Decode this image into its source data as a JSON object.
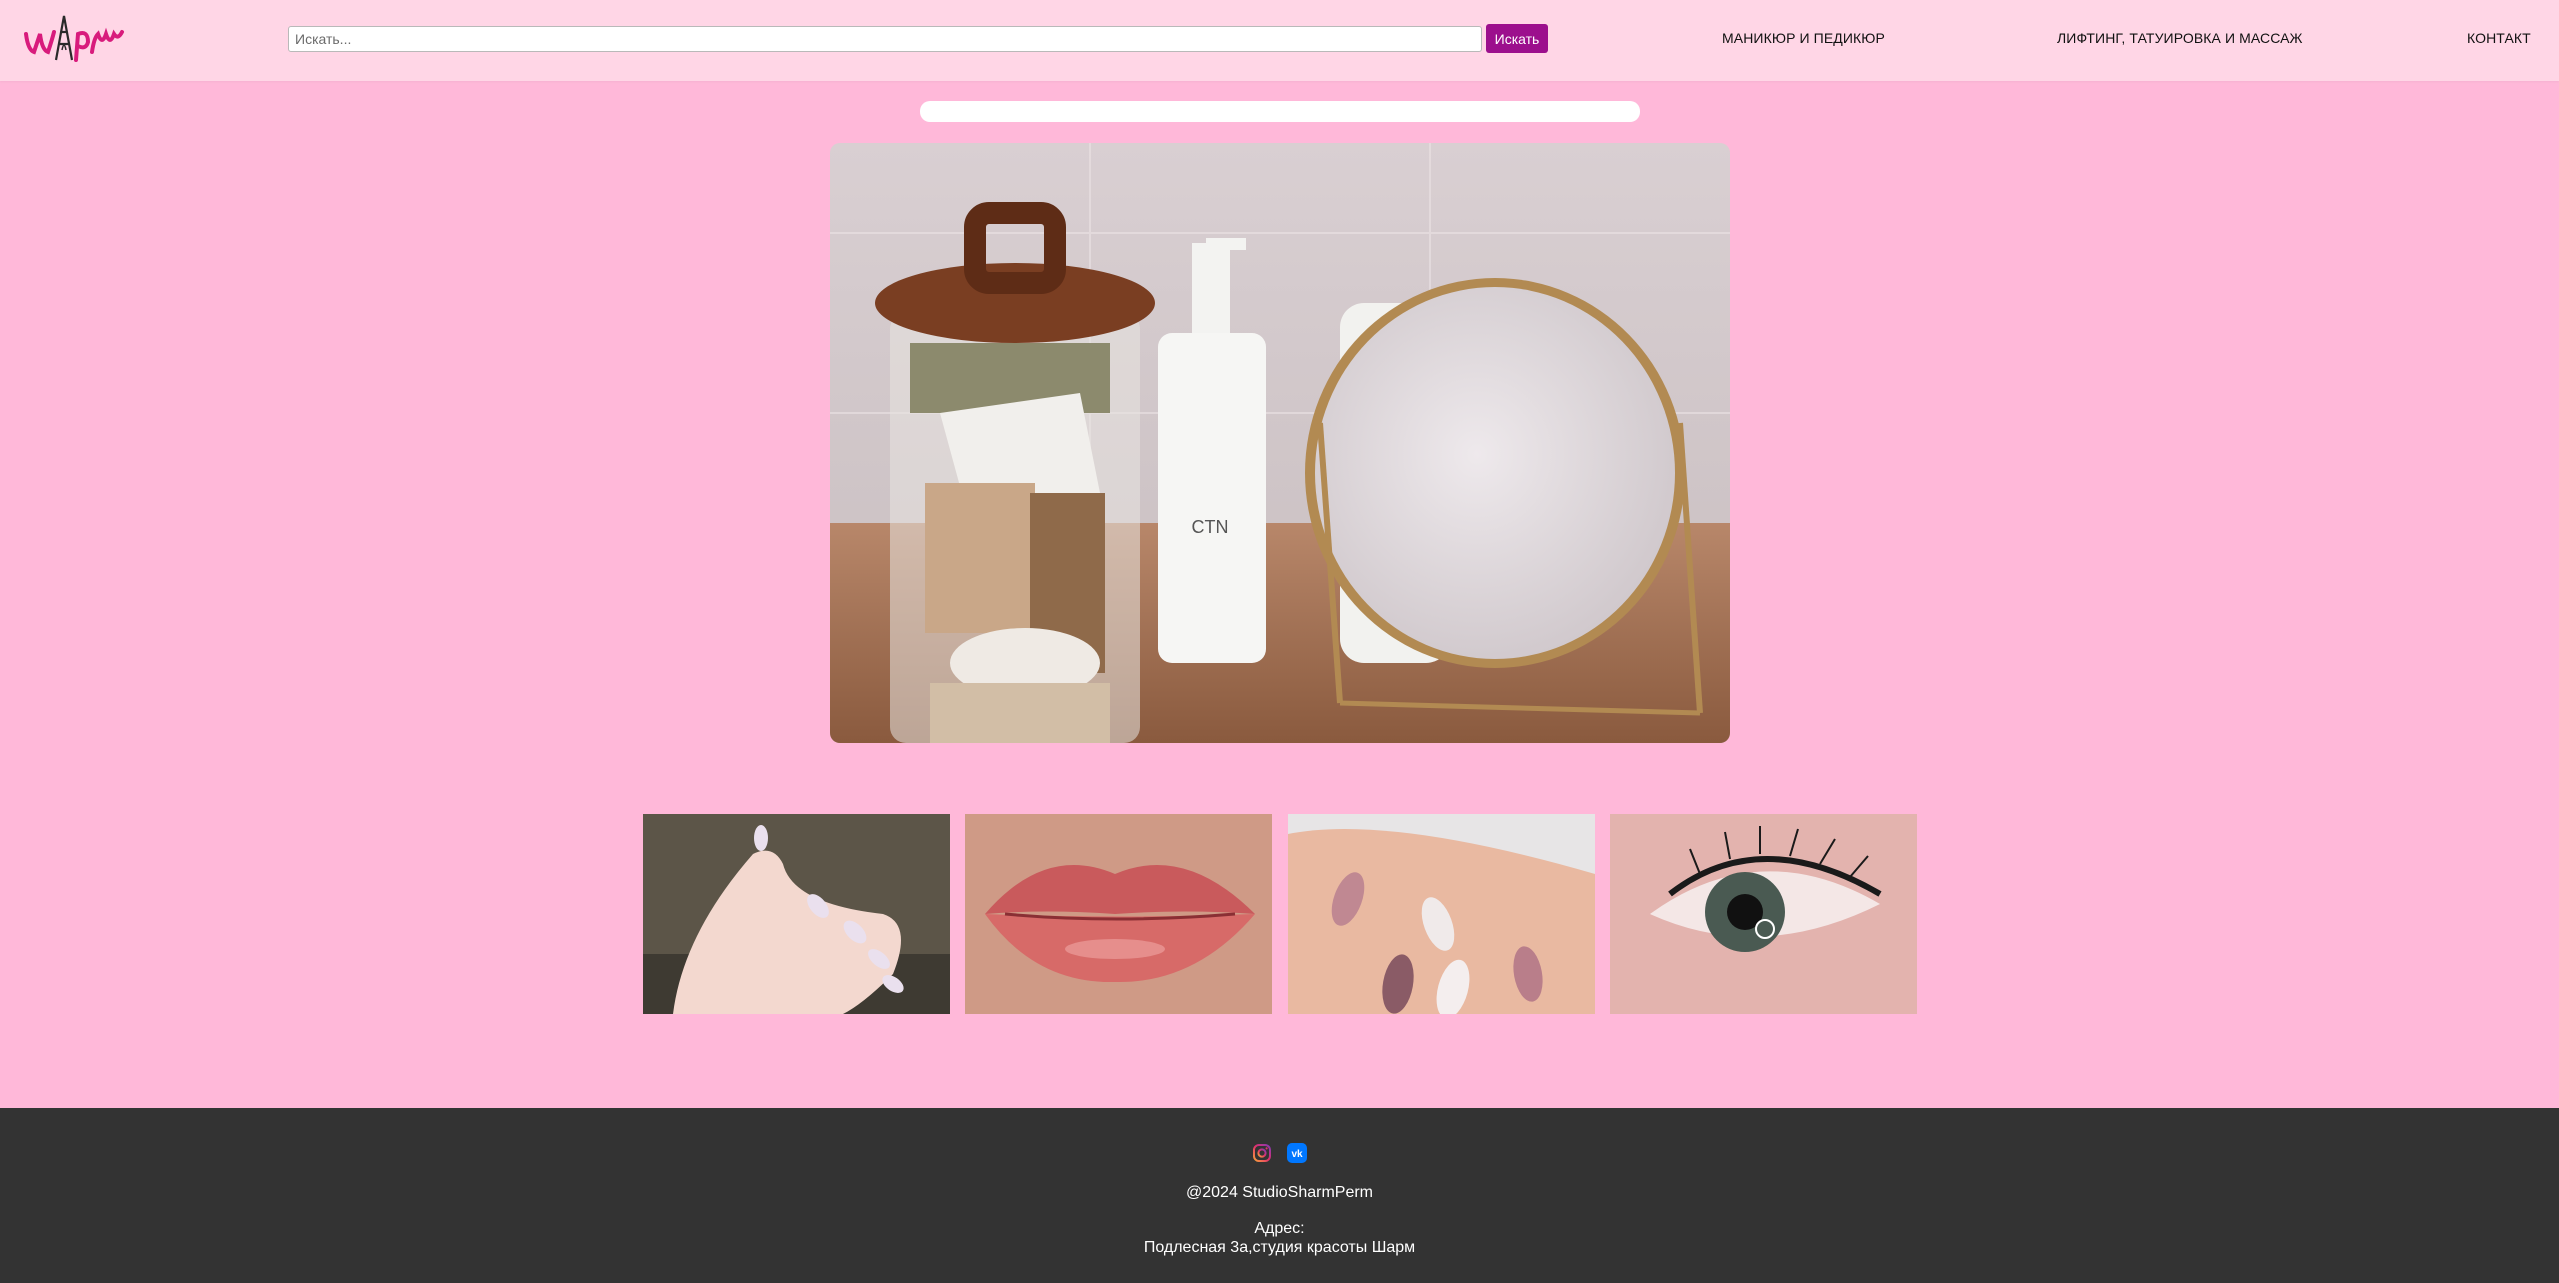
{
  "header": {
    "logo_text": "Шарм",
    "search": {
      "placeholder": "Искать...",
      "value": "",
      "button_label": "Искать"
    },
    "nav": [
      {
        "label": "МАНИКЮР И ПЕДИКЮР"
      },
      {
        "label": "ЛИФТИНГ, ТАТУИРОВКА И МАССАЖ"
      },
      {
        "label": "КОНТАКТ"
      }
    ]
  },
  "main": {
    "hero_image": "cosmetics-jar-bottles-mirror-photo",
    "gallery": [
      {
        "image": "manicure-hand-photo"
      },
      {
        "image": "lips-permanent-makeup-photo"
      },
      {
        "image": "nail-design-photo"
      },
      {
        "image": "eyelash-lamination-photo"
      }
    ]
  },
  "footer": {
    "social": [
      {
        "icon": "instagram-icon"
      },
      {
        "icon": "vk-icon"
      }
    ],
    "copyright": "@2024 StudioSharmPerm",
    "address_label": "Адрес:",
    "address": "Подлесная 3а,студия красоты Шарм"
  },
  "colors": {
    "page_bg": "#ffb8d9",
    "header_bg": "#ffd6e6",
    "accent": "#9c0f8d",
    "footer_bg": "#333333"
  }
}
